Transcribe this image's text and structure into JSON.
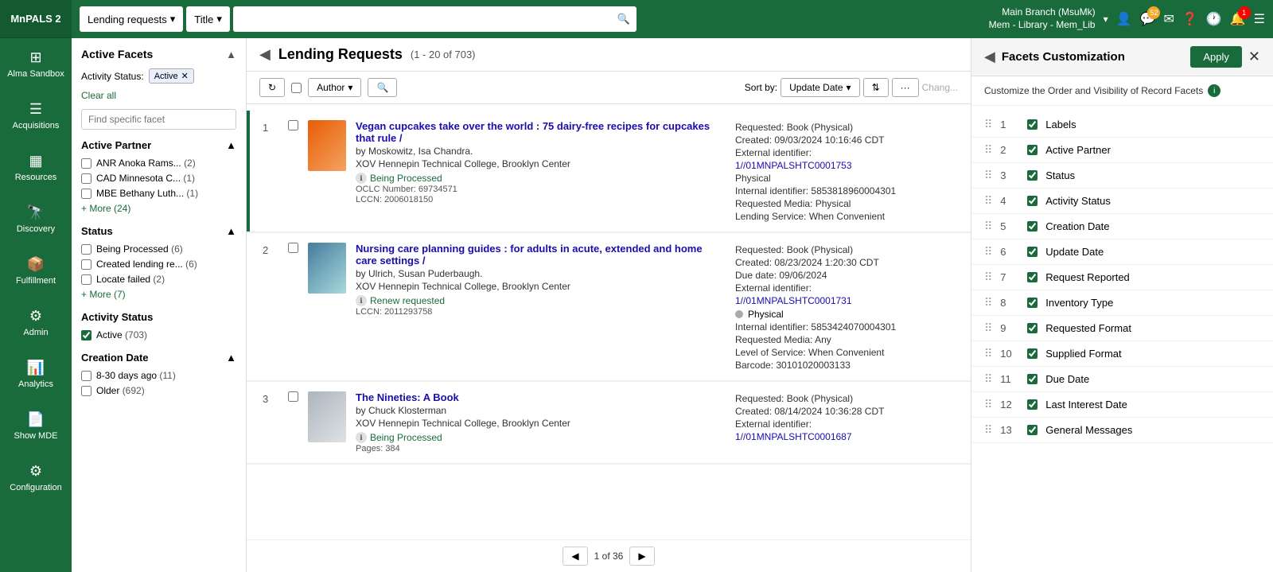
{
  "logo": {
    "text": "MnPALS 2"
  },
  "header": {
    "search_type": "Lending requests",
    "search_field": "Title",
    "branch": "Main Branch (MsuMk)",
    "branch_sub": "Mem - Library - Mem_Lib",
    "icons": {
      "chat_badge": "52",
      "alert_badge": "1"
    }
  },
  "nav": [
    {
      "id": "alma-sandbox",
      "icon": "⊞",
      "label": "Alma Sandbox"
    },
    {
      "id": "acquisitions",
      "icon": "☰",
      "label": "Acquisitions"
    },
    {
      "id": "resources",
      "icon": "▦",
      "label": "Resources"
    },
    {
      "id": "discovery",
      "icon": "🔭",
      "label": "Discovery"
    },
    {
      "id": "fulfillment",
      "icon": "📦",
      "label": "Fulfillment"
    },
    {
      "id": "admin",
      "icon": "⚙",
      "label": "Admin"
    },
    {
      "id": "analytics",
      "icon": "📊",
      "label": "Analytics"
    },
    {
      "id": "show-mde",
      "icon": "📄",
      "label": "Show MDE"
    },
    {
      "id": "configuration",
      "icon": "⚙",
      "label": "Configuration"
    }
  ],
  "facets": {
    "title": "Active Facets",
    "activity_status_label": "Activity Status:",
    "active_badge": "Active",
    "clear_all": "Clear all",
    "find_placeholder": "Find specific facet",
    "sections": [
      {
        "id": "active-partner",
        "label": "Active Partner",
        "expanded": true,
        "items": [
          {
            "label": "ANR Anoka Rams...",
            "count": "(2)",
            "checked": false
          },
          {
            "label": "CAD Minnesota C...",
            "count": "(1)",
            "checked": false
          },
          {
            "label": "MBE Bethany Luth...",
            "count": "(1)",
            "checked": false
          }
        ],
        "more": "+ More (24)"
      },
      {
        "id": "status",
        "label": "Status",
        "expanded": true,
        "items": [
          {
            "label": "Being Processed",
            "count": "(6)",
            "checked": false
          },
          {
            "label": "Created lending re...",
            "count": "(6)",
            "checked": false
          },
          {
            "label": "Locate failed",
            "count": "(2)",
            "checked": false
          }
        ],
        "more": "+ More (7)"
      },
      {
        "id": "activity-status",
        "label": "Activity Status",
        "expanded": true,
        "items": [
          {
            "label": "Active",
            "count": "(703)",
            "checked": true
          }
        ]
      },
      {
        "id": "creation-date",
        "label": "Creation Date",
        "expanded": true,
        "items": [
          {
            "label": "8-30 days ago",
            "count": "(11)",
            "checked": false
          },
          {
            "label": "Older",
            "count": "(692)",
            "checked": false
          }
        ]
      }
    ]
  },
  "results": {
    "title": "Lending Requests",
    "count": "(1 - 20 of 703)",
    "sort_by_label": "Sort by:",
    "sort_by_value": "Update Date",
    "filter_label": "Author",
    "items": [
      {
        "num": "1",
        "title": "Vegan cupcakes take over the world : 75 dairy-free recipes for cupcakes that rule /",
        "author": "by Moskowitz, Isa Chandra.",
        "location": "XOV Hennepin Technical College, Brooklyn Center",
        "status": "Being Processed",
        "requested": "Book (Physical)",
        "created": "09/03/2024 10:16:46 CDT",
        "external_id": "1//01MNPALSHTC0001753",
        "internal_id": "5853818960004301",
        "requested_media": "Physical",
        "lending_service": "When Convenient",
        "oclc": "69734571",
        "lccn": "2006018150",
        "thumb_class": "thumb-orange"
      },
      {
        "num": "2",
        "title": "Nursing care planning guides : for adults in acute, extended and home care settings /",
        "author": "by Ulrich, Susan Puderbaugh.",
        "location": "XOV Hennepin Technical College, Brooklyn Center",
        "status": "Renew requested",
        "requested": "Book (Physical)",
        "created": "08/23/2024 1:20:30 CDT",
        "due_date": "09/06/2024",
        "external_id": "1//01MNPALSHTC0001731",
        "internal_id": "5853424070004301",
        "requested_media": "Any",
        "lending_service": "When Convenient",
        "barcode": "30101020003133",
        "lccn": "2011293758",
        "thumb_class": "thumb-blue"
      },
      {
        "num": "3",
        "title": "The Nineties: A Book",
        "author": "by Chuck Klosterman",
        "location": "XOV Hennepin Technical College, Brooklyn Center",
        "status": "Being Processed",
        "requested": "Book (Physical)",
        "created": "08/14/2024 10:36:28 CDT",
        "external_id": "1//01MNPALSHTC0001687",
        "pages": "384",
        "thumb_class": "thumb-gray"
      }
    ],
    "pagination": {
      "current_page": "1 of 36",
      "prev_label": "◀",
      "next_label": "▶"
    }
  },
  "facets_custom": {
    "title": "Facets Customization",
    "apply_label": "Apply",
    "description": "Customize the Order and Visibility of Record Facets",
    "items": [
      {
        "num": "1",
        "label": "Labels",
        "checked": true
      },
      {
        "num": "2",
        "label": "Active Partner",
        "checked": true
      },
      {
        "num": "3",
        "label": "Status",
        "checked": true
      },
      {
        "num": "4",
        "label": "Activity Status",
        "checked": true
      },
      {
        "num": "5",
        "label": "Creation Date",
        "checked": true
      },
      {
        "num": "6",
        "label": "Update Date",
        "checked": true
      },
      {
        "num": "7",
        "label": "Request Reported",
        "checked": true
      },
      {
        "num": "8",
        "label": "Inventory Type",
        "checked": true
      },
      {
        "num": "9",
        "label": "Requested Format",
        "checked": true
      },
      {
        "num": "10",
        "label": "Supplied Format",
        "checked": true
      },
      {
        "num": "11",
        "label": "Due Date",
        "checked": true
      },
      {
        "num": "12",
        "label": "Last Interest Date",
        "checked": true
      },
      {
        "num": "13",
        "label": "General Messages",
        "checked": true
      }
    ]
  }
}
